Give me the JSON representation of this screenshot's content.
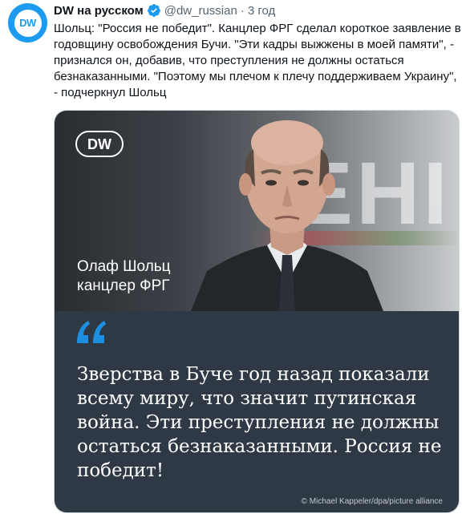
{
  "tweet": {
    "avatar_text": "DW",
    "author_name": "DW на русском",
    "handle": "@dw_russian",
    "separator": "·",
    "time": "3 год",
    "text": "Шольц: \"Россия не победит\". Канцлер ФРГ сделал короткое заявление в годовщину освобождения Бучи. \"Эти кадры выжжены в моей памяти\", - признался он, добавив, что преступления не должны остаться безнаказанными. \"Поэтому мы плечом к плечу поддерживаем Украину\", - подчеркнул Шольц"
  },
  "media": {
    "logo_text": "DW",
    "backdrop_text": "EHI",
    "caption_name": "Олаф Шольц",
    "caption_role": "канцлер ФРГ",
    "quote": "Зверства в Буче год назад показали всему миру, что значит путинская война. Эти преступления не должны остаться безнаказанными. Россия не победит!",
    "credit": "© Michael Kappeler/dpa/picture alliance"
  },
  "colors": {
    "accent": "#1d9bf0",
    "quote_panel": "#2e3945",
    "quote_mark": "#1d8fe0"
  }
}
